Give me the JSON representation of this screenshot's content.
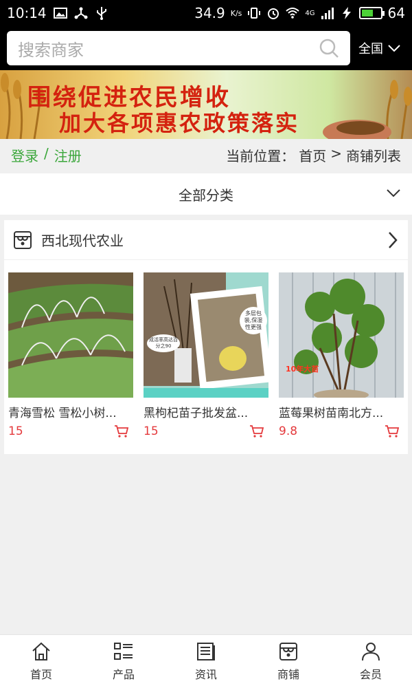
{
  "status_bar": {
    "time": "10:14",
    "speed": "34.9",
    "speed_unit": "K/s",
    "network": "4G",
    "battery": "64",
    "battery_level": 0.64
  },
  "search": {
    "placeholder": "搜索商家",
    "region": "全国"
  },
  "banner": {
    "line1": "围绕促进农民增收",
    "line2": "加大各项惠农政策落实"
  },
  "auth": {
    "login": "登录",
    "separator": "/",
    "register": "注册"
  },
  "breadcrumb": {
    "label": "当前位置：",
    "home": "首页",
    "sep": ">",
    "current": "商铺列表"
  },
  "category": {
    "label": "全部分类"
  },
  "shop": {
    "name": "西北现代农业",
    "products": [
      {
        "title": "青海雪松 雪松小树...",
        "price": "15"
      },
      {
        "title": "黑枸杞苗子批发盆...",
        "price": "15",
        "img_tag1": "成活率高达百分之90",
        "img_tag2": "多层包装,保湿性更强"
      },
      {
        "title": "蓝莓果树苗南北方...",
        "price": "9.8",
        "img_tag": "10年大苗"
      }
    ]
  },
  "bottom_nav": [
    {
      "label": "首页",
      "icon": "home-icon"
    },
    {
      "label": "产品",
      "icon": "product-list-icon"
    },
    {
      "label": "资讯",
      "icon": "news-icon"
    },
    {
      "label": "商铺",
      "icon": "shop-icon"
    },
    {
      "label": "会员",
      "icon": "member-icon"
    }
  ],
  "colors": {
    "accent_green": "#3aa63a",
    "price_red": "#e4393c",
    "banner_text": "#d4220f"
  }
}
